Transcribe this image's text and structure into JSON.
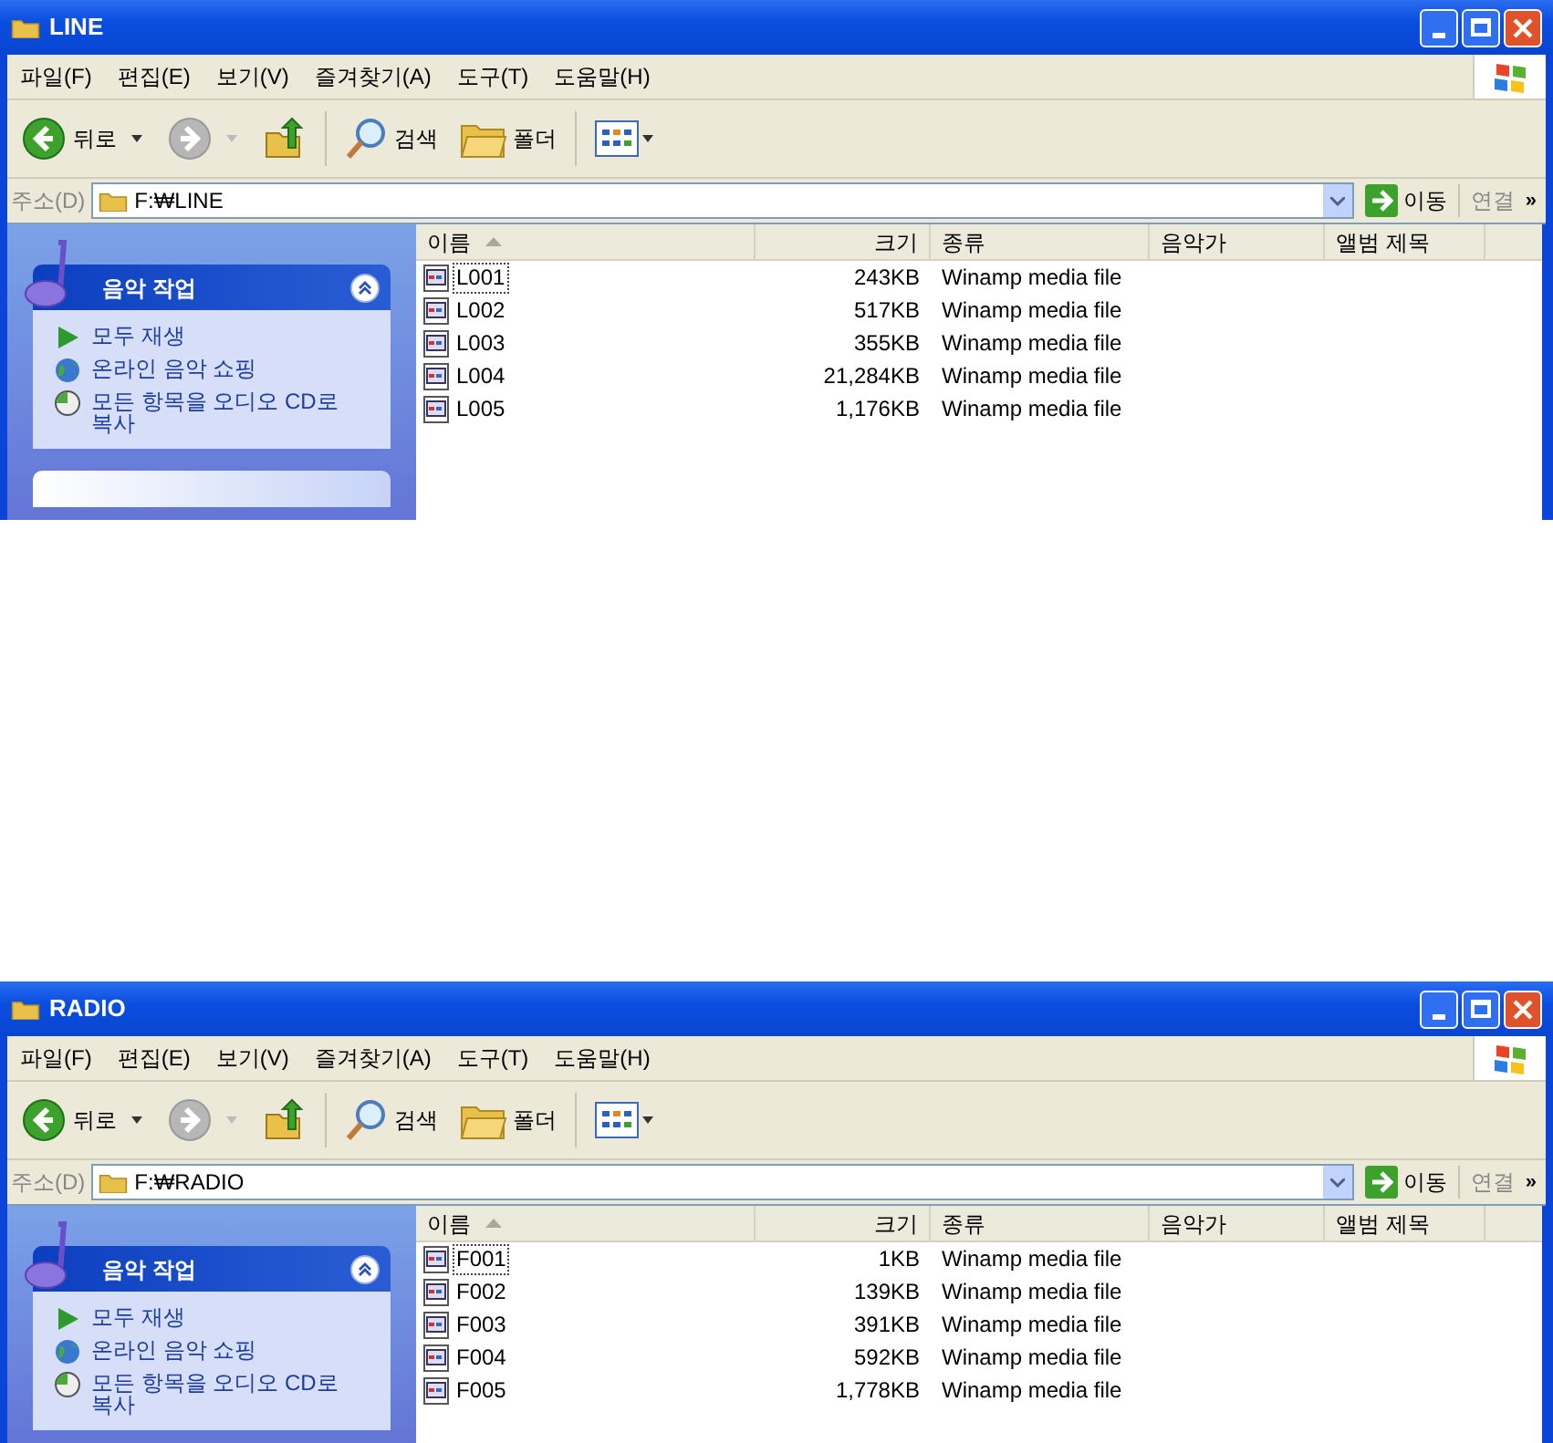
{
  "windows": [
    {
      "title": "LINE",
      "menu": [
        "파일(F)",
        "편집(E)",
        "보기(V)",
        "즐겨찾기(A)",
        "도구(T)",
        "도움말(H)"
      ],
      "toolbar": {
        "back": "뒤로",
        "search": "검색",
        "folders": "폴더"
      },
      "address": {
        "label": "주소(D)",
        "value": "F:₩LINE",
        "go": "이동",
        "links": "연결",
        "more": "»"
      },
      "task_panel": {
        "next_panel_visible": true,
        "title": "음악 작업",
        "tasks": [
          "모두 재생",
          "온라인 음악 쇼핑",
          "모든 항목을 오디오 CD로 복사"
        ]
      },
      "columns": [
        {
          "label": "이름",
          "sorted": true
        },
        {
          "label": "크기",
          "sorted": false
        },
        {
          "label": "종류",
          "sorted": false
        },
        {
          "label": "음악가",
          "sorted": false
        },
        {
          "label": "앨범 제목",
          "sorted": false
        }
      ],
      "files": [
        {
          "name": "L001",
          "size": "243KB",
          "type": "Winamp media file",
          "focused": true
        },
        {
          "name": "L002",
          "size": "517KB",
          "type": "Winamp media file",
          "focused": false
        },
        {
          "name": "L003",
          "size": "355KB",
          "type": "Winamp media file",
          "focused": false
        },
        {
          "name": "L004",
          "size": "21,284KB",
          "type": "Winamp media file",
          "focused": false
        },
        {
          "name": "L005",
          "size": "1,176KB",
          "type": "Winamp media file",
          "focused": false
        }
      ]
    },
    {
      "title": "RADIO",
      "menu": [
        "파일(F)",
        "편집(E)",
        "보기(V)",
        "즐겨찾기(A)",
        "도구(T)",
        "도움말(H)"
      ],
      "toolbar": {
        "back": "뒤로",
        "search": "검색",
        "folders": "폴더"
      },
      "address": {
        "label": "주소(D)",
        "value": "F:₩RADIO",
        "go": "이동",
        "links": "연결",
        "more": "»"
      },
      "task_panel": {
        "title": "음악 작업",
        "tasks": [
          "모두 재생",
          "온라인 음악 쇼핑",
          "모든 항목을 오디오 CD로 복사"
        ]
      },
      "columns": [
        {
          "label": "이름",
          "sorted": true
        },
        {
          "label": "크기",
          "sorted": false
        },
        {
          "label": "종류",
          "sorted": false
        },
        {
          "label": "음악가",
          "sorted": false
        },
        {
          "label": "앨범 제목",
          "sorted": false
        }
      ],
      "files": [
        {
          "name": "F001",
          "size": "1KB",
          "type": "Winamp media file",
          "focused": true
        },
        {
          "name": "F002",
          "size": "139KB",
          "type": "Winamp media file",
          "focused": false
        },
        {
          "name": "F003",
          "size": "391KB",
          "type": "Winamp media file",
          "focused": false
        },
        {
          "name": "F004",
          "size": "592KB",
          "type": "Winamp media file",
          "focused": false
        },
        {
          "name": "F005",
          "size": "1,778KB",
          "type": "Winamp media file",
          "focused": false
        }
      ]
    }
  ]
}
